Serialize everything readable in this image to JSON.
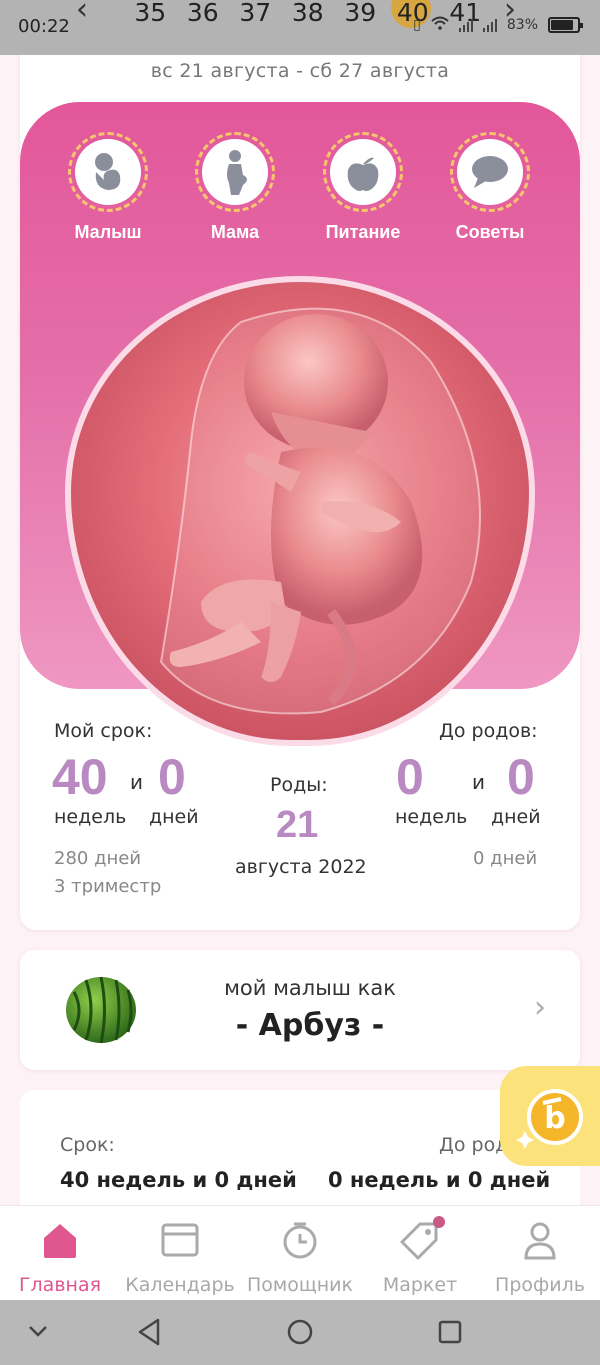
{
  "status_bar": {
    "time": "00:22",
    "battery": "83%",
    "battery_level": 0.83
  },
  "week_strip": {
    "weeks": [
      "35",
      "36",
      "37",
      "38",
      "39",
      "40",
      "41"
    ],
    "active_week": "40"
  },
  "main": {
    "date_range": "вс 21 августа - сб 27 августа",
    "categories": [
      {
        "label": "Малыш",
        "icon": "baby-icon"
      },
      {
        "label": "Мама",
        "icon": "mother-icon"
      },
      {
        "label": "Питание",
        "icon": "apple-icon"
      },
      {
        "label": "Советы",
        "icon": "chat-bubble-icon"
      }
    ],
    "my_term": {
      "label": "Мой срок:",
      "weeks": "40",
      "and": "и",
      "days": "0",
      "weeks_unit": "недель",
      "days_unit": "дней",
      "total_days": "280 дней",
      "trimester": "3 триместр"
    },
    "birth": {
      "label": "Роды:",
      "day": "21",
      "month_year": "августа 2022"
    },
    "until_birth": {
      "label": "До родов:",
      "weeks": "0",
      "and": "и",
      "days": "0",
      "weeks_unit": "недель",
      "days_unit": "дней",
      "total_days": "0 дней"
    }
  },
  "fruit_card": {
    "subtitle": "мой малыш как",
    "name": "- Арбуз -"
  },
  "term_card": {
    "term_label": "Срок:",
    "term_value": "40 недель и 0 дней",
    "until_label": "До родов:",
    "until_value": "0 недель и 0 дней"
  },
  "bottom_nav": [
    {
      "label": "Главная",
      "icon": "home-icon",
      "active": true
    },
    {
      "label": "Календарь",
      "icon": "calendar-icon",
      "active": false
    },
    {
      "label": "Помощник",
      "icon": "timer-icon",
      "active": false
    },
    {
      "label": "Маркет",
      "icon": "tag-icon",
      "active": false
    },
    {
      "label": "Профиль",
      "icon": "profile-icon",
      "active": false
    }
  ],
  "colors": {
    "accent_pink": "#e3579a",
    "number_purple": "#b88ac1",
    "nav_active": "#e0578f"
  }
}
